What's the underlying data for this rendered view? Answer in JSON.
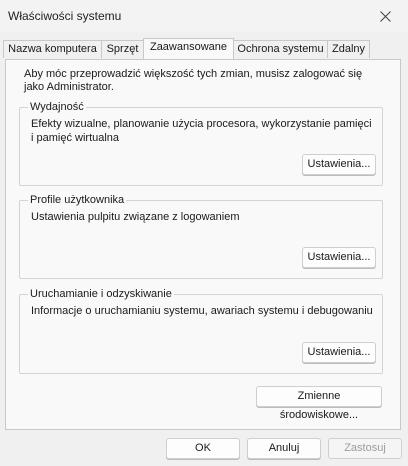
{
  "window": {
    "title": "Właściwości systemu",
    "close_icon": "close-icon"
  },
  "tabs": [
    {
      "label": "Nazwa komputera",
      "active": false
    },
    {
      "label": "Sprzęt",
      "active": false
    },
    {
      "label": "Zaawansowane",
      "active": true
    },
    {
      "label": "Ochrona systemu",
      "active": false
    },
    {
      "label": "Zdalny",
      "active": false
    }
  ],
  "panel": {
    "intro": "Aby móc przeprowadzić większość tych zmian, musisz zalogować się jako Administrator.",
    "groups": [
      {
        "title": "Wydajność",
        "description": "Efekty wizualne, planowanie użycia procesora, wykorzystanie pamięci i pamięć wirtualna",
        "button": "Ustawienia..."
      },
      {
        "title": "Profile użytkownika",
        "description": "Ustawienia pulpitu związane z logowaniem",
        "button": "Ustawienia..."
      },
      {
        "title": "Uruchamianie i odzyskiwanie",
        "description": "Informacje o uruchamianiu systemu, awariach systemu i debugowaniu",
        "button": "Ustawienia..."
      }
    ],
    "env_button": "Zmienne środowiskowe..."
  },
  "footer": {
    "ok": "OK",
    "cancel": "Anuluj",
    "apply": "Zastosuj",
    "apply_disabled": true
  }
}
